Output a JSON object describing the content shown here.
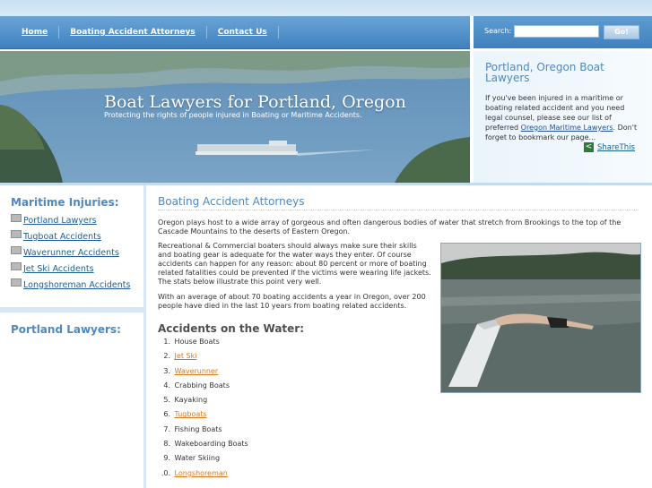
{
  "nav": {
    "items": [
      {
        "label": "Home"
      },
      {
        "label": "Boating Accident Attorneys"
      },
      {
        "label": "Contact Us"
      }
    ]
  },
  "search": {
    "label": "Search:",
    "placeholder": "",
    "value": "",
    "button_label": "Go!"
  },
  "hero": {
    "title": "Boat Lawyers for Portland, Oregon",
    "subtitle": "Protecting the rights of people injured in Boating or Maritime Accidents."
  },
  "right_panel": {
    "title": "Portland, Oregon Boat Lawyers",
    "text_before": "If you've been injured in a maritime or boating related accident and you need legal counsel, please see our list of preferred ",
    "link_text": "Oregon Maritime Lawyers",
    "text_after": ". Don't forget to bookmark our page...",
    "share_label": "ShareThis"
  },
  "sidebar": {
    "title1": "Maritime Injuries:",
    "items": [
      {
        "label": "Portland Lawyers"
      },
      {
        "label": "Tugboat Accidents"
      },
      {
        "label": "Waverunner Accidents"
      },
      {
        "label": "Jet Ski Accidents"
      },
      {
        "label": "Longshoreman Accidents"
      }
    ],
    "title2": "Portland Lawyers:"
  },
  "main": {
    "title": "Boating Accident Attorneys",
    "p1": "Oregon plays host to a wide array of gorgeous and often dangerous bodies of water that stretch from Brookings to the top of the Cascade Mountains to the deserts of Eastern Oregon.",
    "p2": "Recreational & Commercial boaters should always make sure their skills and boating gear is adequate for the water ways they enter. Of course accidents can happen for any reason: about 80 percent or more of boating related fatalities could be prevented if the victims were wearing life jackets. The stats below illustrate this point very well.",
    "p3": "With an average of about 70 boating accidents a year in Oregon, over 200 people have died in the last 10 years from boating related accidents.",
    "accidents_title": "Accidents on the Water:",
    "accidents": [
      {
        "num": "1.",
        "label": "House Boats",
        "link": false
      },
      {
        "num": "2.",
        "label": "Jet Ski",
        "link": true
      },
      {
        "num": "3.",
        "label": "Waverunner",
        "link": true
      },
      {
        "num": "4.",
        "label": "Crabbing Boats",
        "link": false
      },
      {
        "num": "5.",
        "label": "Kayaking",
        "link": false
      },
      {
        "num": "6.",
        "label": "Tugboats",
        "link": true
      },
      {
        "num": "7.",
        "label": "Fishing Boats",
        "link": false
      },
      {
        "num": "8.",
        "label": "Wakeboarding Boats",
        "link": false
      },
      {
        "num": "9.",
        "label": "Water Skiing",
        "link": false
      },
      {
        "num": ".0.",
        "label": "Longshoreman",
        "link": true
      }
    ]
  },
  "colors": {
    "nav_blue": "#3f80bf",
    "heading_blue": "#4f89bf",
    "link_orange": "#d47a17"
  }
}
